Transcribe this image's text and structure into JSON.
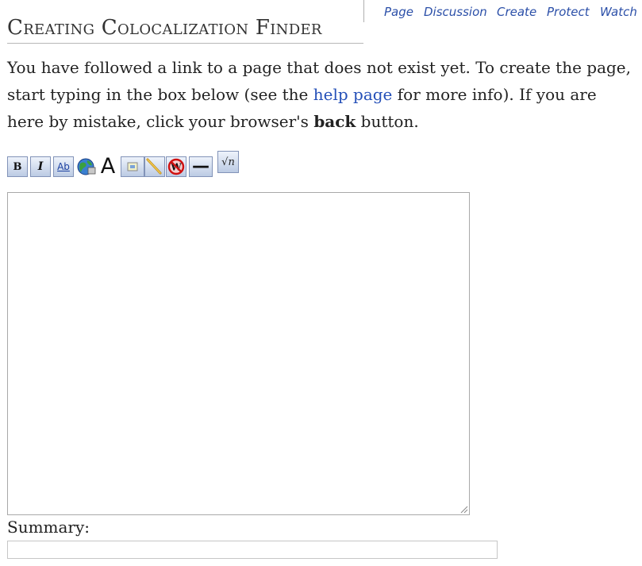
{
  "tabs": [
    {
      "label": "Page"
    },
    {
      "label": "Discussion"
    },
    {
      "label": "Create"
    },
    {
      "label": "Protect"
    },
    {
      "label": "Watch"
    }
  ],
  "page_title": "Creating Colocalization Finder",
  "intro": {
    "part1": "You have followed a link to a page that does not exist yet. To create the page, start typing in the box below (see the ",
    "help_link": "help page",
    "part2": " for more info). If you are here by mistake, click your browser's ",
    "back_word": "back",
    "part3": " button."
  },
  "toolbar": [
    {
      "name": "bold-button",
      "glyph": "B"
    },
    {
      "name": "italic-button",
      "glyph": "I"
    },
    {
      "name": "internal-link-button",
      "glyph": "Ab"
    },
    {
      "name": "external-link-button",
      "glyph": "globe-icon"
    },
    {
      "name": "headline-button",
      "glyph": "A"
    },
    {
      "name": "embedded-file-button",
      "glyph": "image-icon"
    },
    {
      "name": "file-link-button",
      "glyph": "media-icon"
    },
    {
      "name": "nowiki-button",
      "glyph": "W"
    },
    {
      "name": "horizontal-line-button",
      "glyph": "—"
    },
    {
      "name": "math-formula-button",
      "glyph": "√n"
    }
  ],
  "editor": {
    "value": ""
  },
  "summary": {
    "label": "Summary:",
    "value": ""
  },
  "colors": {
    "link": "#2550b8",
    "toolbar_border": "#8293b8"
  }
}
